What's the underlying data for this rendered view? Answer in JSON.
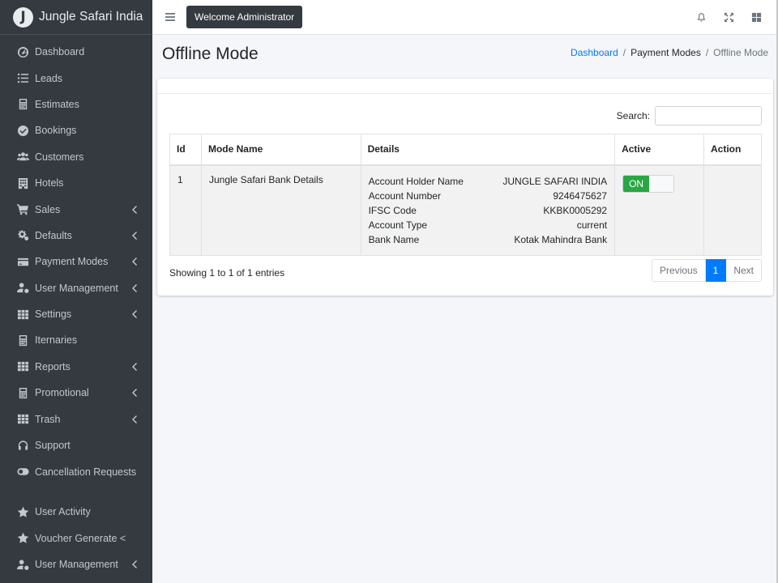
{
  "brand": {
    "logo_letter": "J",
    "name": "Jungle Safari India"
  },
  "sidebar": {
    "items": [
      {
        "label": "Dashboard",
        "icon": "dashboard-icon",
        "has_submenu": false
      },
      {
        "label": "Leads",
        "icon": "list-icon",
        "has_submenu": false
      },
      {
        "label": "Estimates",
        "icon": "calculator-icon",
        "has_submenu": false
      },
      {
        "label": "Bookings",
        "icon": "check-circle-icon",
        "has_submenu": false
      },
      {
        "label": "Customers",
        "icon": "users-icon",
        "has_submenu": false
      },
      {
        "label": "Hotels",
        "icon": "building-icon",
        "has_submenu": false
      },
      {
        "label": "Sales",
        "icon": "cart-icon",
        "has_submenu": true
      },
      {
        "label": "Defaults",
        "icon": "cogs-icon",
        "has_submenu": true
      },
      {
        "label": "Payment Modes",
        "icon": "credit-card-icon",
        "has_submenu": true
      },
      {
        "label": "User Management",
        "icon": "user-gear-icon",
        "has_submenu": true
      },
      {
        "label": "Settings",
        "icon": "grid-icon",
        "has_submenu": true
      },
      {
        "label": "Iternaries",
        "icon": "calculator-icon",
        "has_submenu": false
      },
      {
        "label": "Reports",
        "icon": "grid-icon",
        "has_submenu": true
      },
      {
        "label": "Promotional",
        "icon": "calculator-icon",
        "has_submenu": true
      },
      {
        "label": "Trash",
        "icon": "grid-icon",
        "has_submenu": true
      },
      {
        "label": "Support",
        "icon": "headset-icon",
        "has_submenu": false
      },
      {
        "label": "Cancellation Requests",
        "icon": "toggle-icon",
        "has_submenu": false
      },
      {
        "label": "User Activity",
        "icon": "star-icon",
        "has_submenu": false
      },
      {
        "label": "Voucher Generate <",
        "icon": "star-icon",
        "has_submenu": false
      },
      {
        "label": "User Management",
        "icon": "user-gear-icon",
        "has_submenu": true
      }
    ]
  },
  "header": {
    "welcome": "Welcome Administrator",
    "icons": [
      "bell-icon",
      "expand-icon",
      "apps-icon"
    ]
  },
  "page": {
    "title": "Offline Mode",
    "breadcrumb": {
      "home": "Dashboard",
      "parent": "Payment Modes",
      "current": "Offline Mode"
    }
  },
  "table": {
    "search_label": "Search:",
    "search_value": "",
    "columns": [
      "Id",
      "Mode Name",
      "Details",
      "Active",
      "Action"
    ],
    "rows": [
      {
        "id": "1",
        "mode_name": "Jungle Safari Bank Details",
        "details": [
          {
            "label": "Account Holder Name",
            "value": "JUNGLE SAFARI INDIA"
          },
          {
            "label": "Account Number",
            "value": "9246475627"
          },
          {
            "label": "IFSC Code",
            "value": "KKBK0005292"
          },
          {
            "label": "Account Type",
            "value": "current"
          },
          {
            "label": "Bank Name",
            "value": "Kotak Mahindra Bank"
          }
        ],
        "active": "ON",
        "action": ""
      }
    ],
    "info": "Showing 1 to 1 of 1 entries",
    "pagination": {
      "previous": "Previous",
      "current": "1",
      "next": "Next"
    }
  },
  "colors": {
    "sidebar_bg": "#343a40",
    "primary": "#007bff",
    "success": "#28a745",
    "page_bg": "#f4f6f9"
  }
}
